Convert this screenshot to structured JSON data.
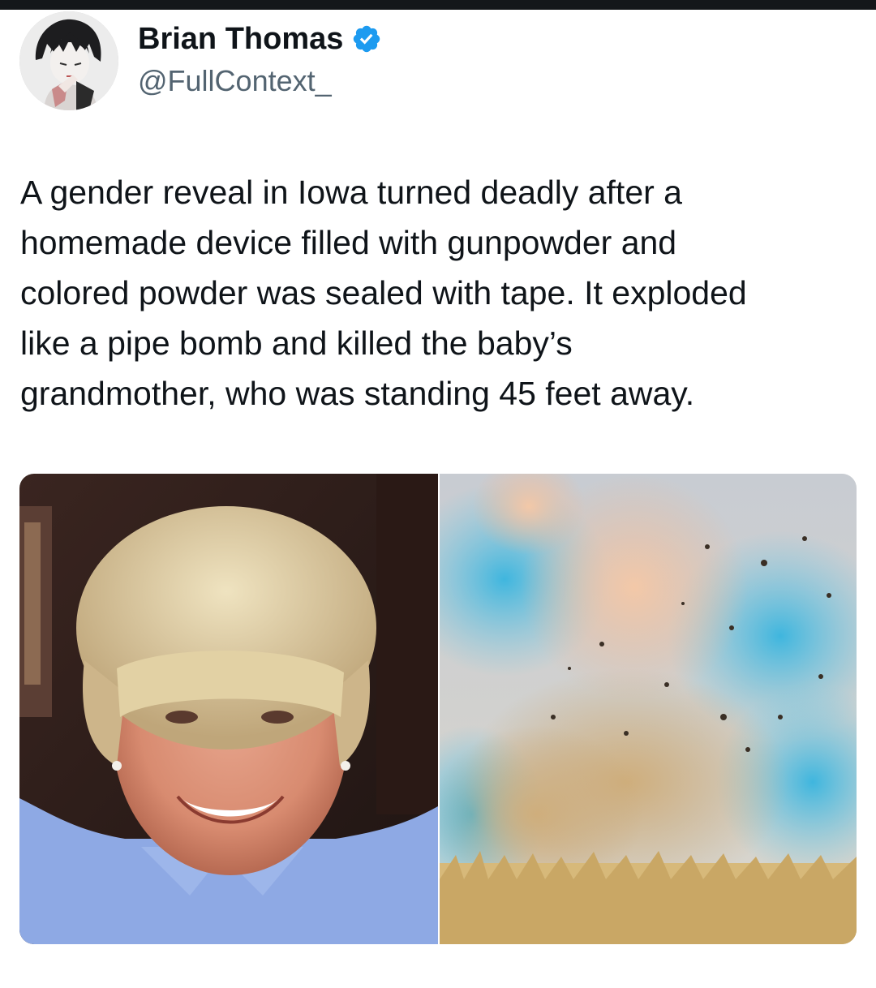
{
  "author": {
    "display_name": "Brian Thomas",
    "handle": "@FullContext_",
    "verified": true,
    "avatar_icon": "anime-avatar-icon",
    "verified_icon": "verified-badge-icon",
    "verified_color": "#1d9bf0"
  },
  "tweet": {
    "text_lines": [
      "A gender reveal in Iowa turned deadly after a",
      "homemade device filled with gunpowder and",
      "colored powder was sealed with tape. It exploded",
      "like a pipe bomb and killed the baby’s",
      "grandmother, who was standing 45 feet away."
    ]
  },
  "colors": {
    "text": "#0f1419",
    "secondary_text": "#536471",
    "top_bar": "#14171a"
  }
}
